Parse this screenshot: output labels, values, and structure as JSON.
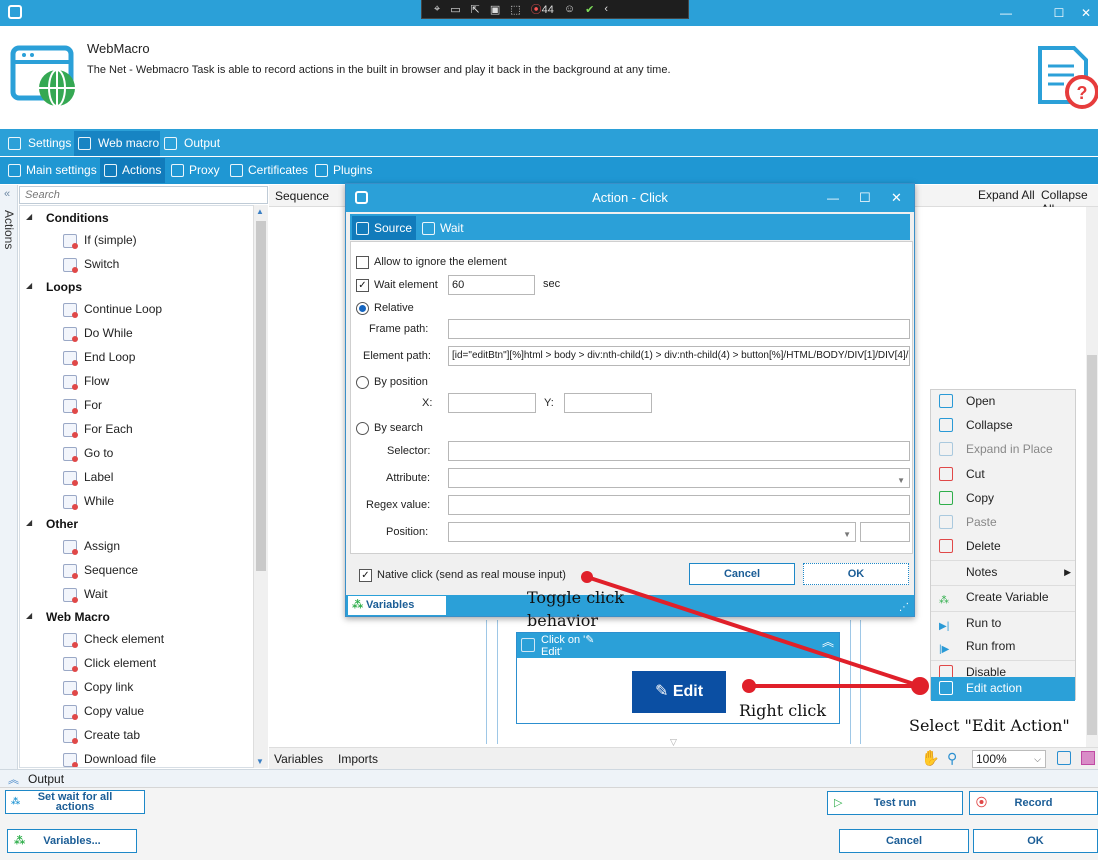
{
  "window": {
    "minimize": "—",
    "maximize": "☐",
    "close": "✕"
  },
  "remote_toolbar": {
    "icons": [
      "cursor-icon",
      "video-icon",
      "pointer-icon",
      "screen-icon",
      "pointer-select-icon",
      "record-icon",
      "accessibility-icon",
      "check-icon"
    ],
    "count": "44",
    "collapse": "‹"
  },
  "header": {
    "title": "WebMacro",
    "description": "The Net - Webmacro Task is able to record actions in the built in browser and play it back in the background at any time."
  },
  "tabs1": [
    {
      "label": "Settings"
    },
    {
      "label": "Web macro"
    },
    {
      "label": "Output"
    }
  ],
  "tabs2": [
    {
      "label": "Main settings"
    },
    {
      "label": "Actions"
    },
    {
      "label": "Proxy"
    },
    {
      "label": "Certificates"
    },
    {
      "label": "Plugins"
    }
  ],
  "left_panel": {
    "vertical_label": "Actions",
    "search_placeholder": "Search",
    "categories": [
      {
        "name": "Conditions",
        "items": [
          "If (simple)",
          "Switch"
        ]
      },
      {
        "name": "Loops",
        "items": [
          "Continue Loop",
          "Do While",
          "End Loop",
          "Flow",
          "For",
          "For Each",
          "Go to",
          "Label",
          "While"
        ]
      },
      {
        "name": "Other",
        "items": [
          "Assign",
          "Sequence",
          "Wait"
        ]
      },
      {
        "name": "Web Macro",
        "items": [
          "Check element",
          "Click element",
          "Copy link",
          "Copy value",
          "Create tab",
          "Download file"
        ]
      }
    ]
  },
  "designer": {
    "sequence_label": "Sequence",
    "expand_all": "Expand All",
    "collapse_all": "Collapse All",
    "bottom_tabs": [
      "Variables",
      "Imports"
    ],
    "zoom": "100%",
    "activity": {
      "title_line1": "Click on '✎",
      "title_line2": "Edit'",
      "button_label": "Edit"
    }
  },
  "context_menu": [
    {
      "label": "Open",
      "enabled": true
    },
    {
      "label": "Collapse",
      "enabled": true
    },
    {
      "label": "Expand in Place",
      "enabled": false
    },
    {
      "label": "Cut",
      "enabled": true
    },
    {
      "label": "Copy",
      "enabled": true
    },
    {
      "label": "Paste",
      "enabled": false
    },
    {
      "label": "Delete",
      "enabled": true
    },
    {
      "label": "Notes",
      "enabled": true,
      "submenu": true
    },
    {
      "label": "Create Variable",
      "enabled": true
    },
    {
      "label": "Run to",
      "enabled": true
    },
    {
      "label": "Run from",
      "enabled": true
    },
    {
      "label": "Disable",
      "enabled": true
    },
    {
      "label": "Edit action",
      "enabled": true,
      "highlighted": true
    }
  ],
  "dialog": {
    "title": "Action - Click",
    "tabs": [
      {
        "label": "Source"
      },
      {
        "label": "Wait"
      }
    ],
    "allow_ignore_label": "Allow to ignore the element",
    "wait_element_label": "Wait element",
    "wait_element_value": "60",
    "wait_unit": "sec",
    "relative_label": "Relative",
    "frame_path_label": "Frame path:",
    "frame_path_value": "",
    "element_path_label": "Element path:",
    "element_path_value": "[id=\"editBtn\"][%]html > body > div:nth-child(1) > div:nth-child(4) > button[%]/HTML/BODY/DIV[1]/DIV[4]/BUTTON",
    "by_position_label": "By position",
    "x_label": "X:",
    "y_label": "Y:",
    "by_search_label": "By search",
    "selector_label": "Selector:",
    "attribute_label": "Attribute:",
    "regex_label": "Regex value:",
    "position_label": "Position:",
    "native_click_label": "Native click (send as real mouse input)",
    "cancel_label": "Cancel",
    "ok_label": "OK",
    "variables_tab": "Variables"
  },
  "bottom": {
    "output_label": "Output",
    "set_wait_line1": "Set wait for all",
    "set_wait_line2": "actions",
    "test_run": "Test run",
    "record": "Record",
    "variables_btn": "Variables...",
    "cancel": "Cancel",
    "ok": "OK"
  },
  "annotations": {
    "toggle_line1": "Toggle click",
    "toggle_line2": "behavior",
    "right_click": "Right click",
    "select_edit": "Select \"Edit Action\"",
    "color": "#e0202a"
  },
  "colors": {
    "accent": "#2ba0d8",
    "accent_dark": "#117bbb",
    "edit_button": "#0b4fa3"
  }
}
